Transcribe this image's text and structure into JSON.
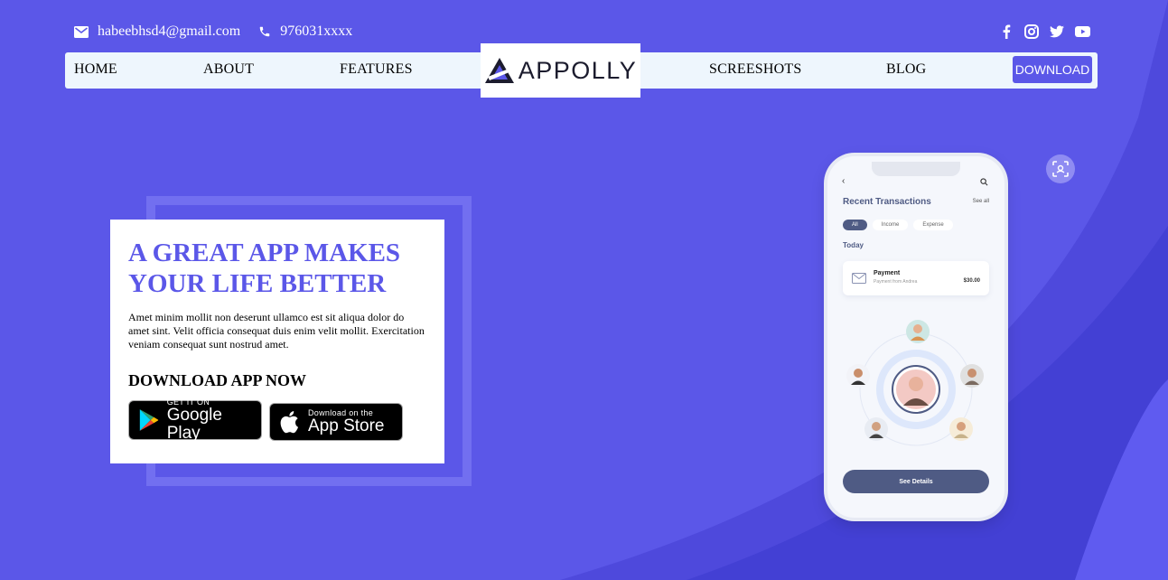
{
  "contact": {
    "email": "habeebhsd4@gmail.com",
    "phone": "976031xxxx"
  },
  "social": [
    "facebook-icon",
    "instagram-icon",
    "twitter-icon",
    "youtube-icon"
  ],
  "nav": {
    "home": "HOME",
    "about": "ABOUT",
    "features": "FEATURES",
    "logo": "APPOLLY",
    "screenshots": "SCREESHOTS",
    "blog": "BLOG",
    "download": "DOWNLOAD"
  },
  "hero": {
    "headline_line1": "A GREAT APP MAKES",
    "headline_line2": "YOUR LIFE BETTER",
    "body": "Amet minim mollit non deserunt ullamco est sit aliqua dolor do amet sint. Velit officia consequat duis enim velit mollit. Exercitation veniam consequat sunt nostrud amet.",
    "cta": "DOWNLOAD APP NOW",
    "google_small": "GET IT ON",
    "google_big": "Google Play",
    "apple_small": "Download on the",
    "apple_big": "App Store"
  },
  "phone": {
    "title": "Recent Transactions",
    "see_all": "See all",
    "chips": [
      "All",
      "Income",
      "Expense"
    ],
    "today": "Today",
    "payment_title": "Payment",
    "payment_sub": "Payment from Andrea",
    "payment_amount": "$30.00",
    "button": "See Details"
  },
  "colors": {
    "background": "#5b57e8",
    "accent": "#5b57e8",
    "nav_bg": "#eef6fd",
    "phone_accent": "#4f5b84"
  }
}
